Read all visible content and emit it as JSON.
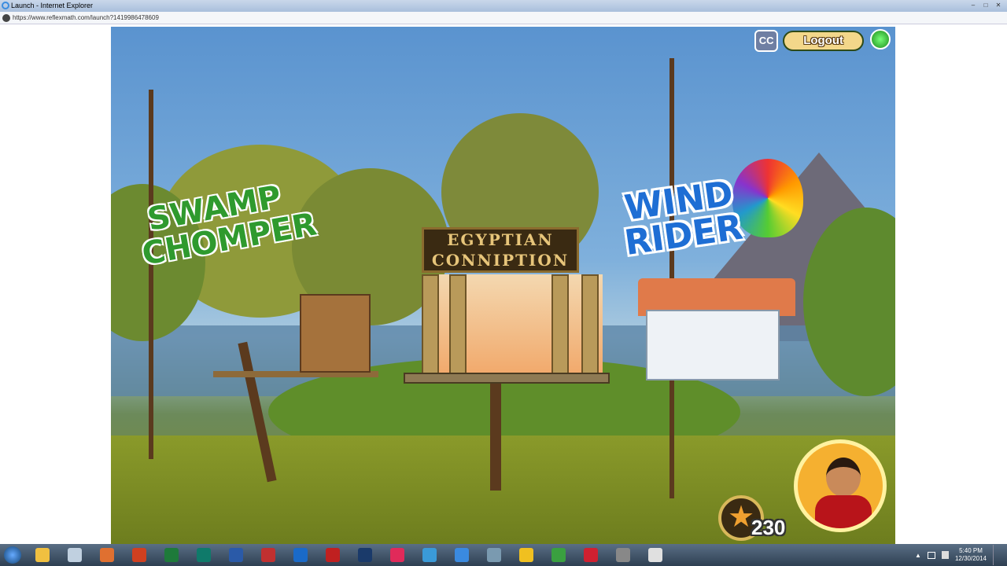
{
  "window": {
    "title": "Launch - Internet Explorer",
    "url": "https://www.reflexmath.com/launch?1419986478609",
    "min": "–",
    "max": "□",
    "close": "✕"
  },
  "game": {
    "cc_label": "CC",
    "logout_label": "Logout",
    "score": "230",
    "star": "★",
    "games": [
      {
        "name": "SWAMP CHOMPER"
      },
      {
        "name": "EGYPTIAN CONNIPTION",
        "line1": "EGYPTIAN",
        "line2": "CONNIPTION"
      },
      {
        "name": "WIND RIDER",
        "line1": "WIND",
        "line2": "RIDER"
      }
    ]
  },
  "taskbar": {
    "apps": [
      {
        "name": "explorer",
        "color": "#f0c040"
      },
      {
        "name": "paint",
        "color": "#c0d0e0"
      },
      {
        "name": "firefox",
        "color": "#e07030"
      },
      {
        "name": "powerpoint",
        "color": "#d04020"
      },
      {
        "name": "excel",
        "color": "#1e7a3a"
      },
      {
        "name": "publisher",
        "color": "#0f7a6a"
      },
      {
        "name": "word",
        "color": "#2a5aa8"
      },
      {
        "name": "app-red",
        "color": "#c03030"
      },
      {
        "name": "outlook",
        "color": "#1a6ac8"
      },
      {
        "name": "acrobat",
        "color": "#c02020"
      },
      {
        "name": "photoshop",
        "color": "#1a3a6a"
      },
      {
        "name": "itunes",
        "color": "#e02a5a"
      },
      {
        "name": "files",
        "color": "#3a9ad8"
      },
      {
        "name": "internet-explorer",
        "color": "#3a8ae0"
      },
      {
        "name": "snipping",
        "color": "#7a9ab0"
      },
      {
        "name": "app-yellow",
        "color": "#f0c020"
      },
      {
        "name": "camtasia",
        "color": "#3aa040"
      },
      {
        "name": "itunes-2",
        "color": "#d02030"
      },
      {
        "name": "settings",
        "color": "#888"
      },
      {
        "name": "camtasia-recorder",
        "color": "#e0e0e0"
      }
    ],
    "time": "5:40 PM",
    "date": "12/30/2014",
    "tray_arrow": "▲"
  }
}
